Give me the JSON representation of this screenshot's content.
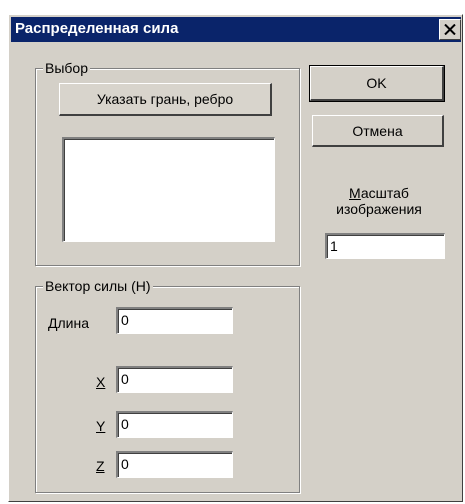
{
  "window": {
    "title": "Распределенная сила"
  },
  "selection_group": {
    "legend": "Выбор",
    "pick_button_label": "Указать грань, ребро",
    "list_items": []
  },
  "buttons": {
    "ok": "OK",
    "cancel": "Отмена"
  },
  "scale": {
    "label_underlined": "М",
    "label_rest_line1": "асштаб",
    "label_line2": "изображения",
    "value": "1"
  },
  "force_vector": {
    "legend": "Вектор силы (H)",
    "length": {
      "underlined": "Д",
      "rest": "лина",
      "value": "0"
    },
    "x": {
      "label": "X",
      "value": "0"
    },
    "y": {
      "label": "Y",
      "value": "0"
    },
    "z": {
      "label": "Z",
      "value": "0"
    }
  },
  "icons": {
    "close": "close-icon"
  }
}
